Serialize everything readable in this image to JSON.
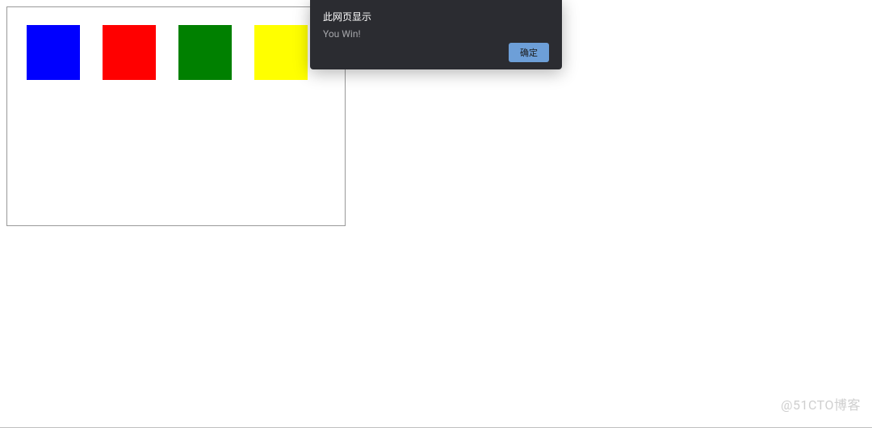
{
  "game": {
    "squares": [
      {
        "name": "blue-square",
        "colorClass": "sq-blue"
      },
      {
        "name": "red-square",
        "colorClass": "sq-red"
      },
      {
        "name": "green-square",
        "colorClass": "sq-green"
      },
      {
        "name": "yellow-square",
        "colorClass": "sq-yellow"
      }
    ]
  },
  "alert": {
    "title": "此网页显示",
    "message": "You Win!",
    "confirm_label": "确定"
  },
  "watermark": "@51CTO博客"
}
